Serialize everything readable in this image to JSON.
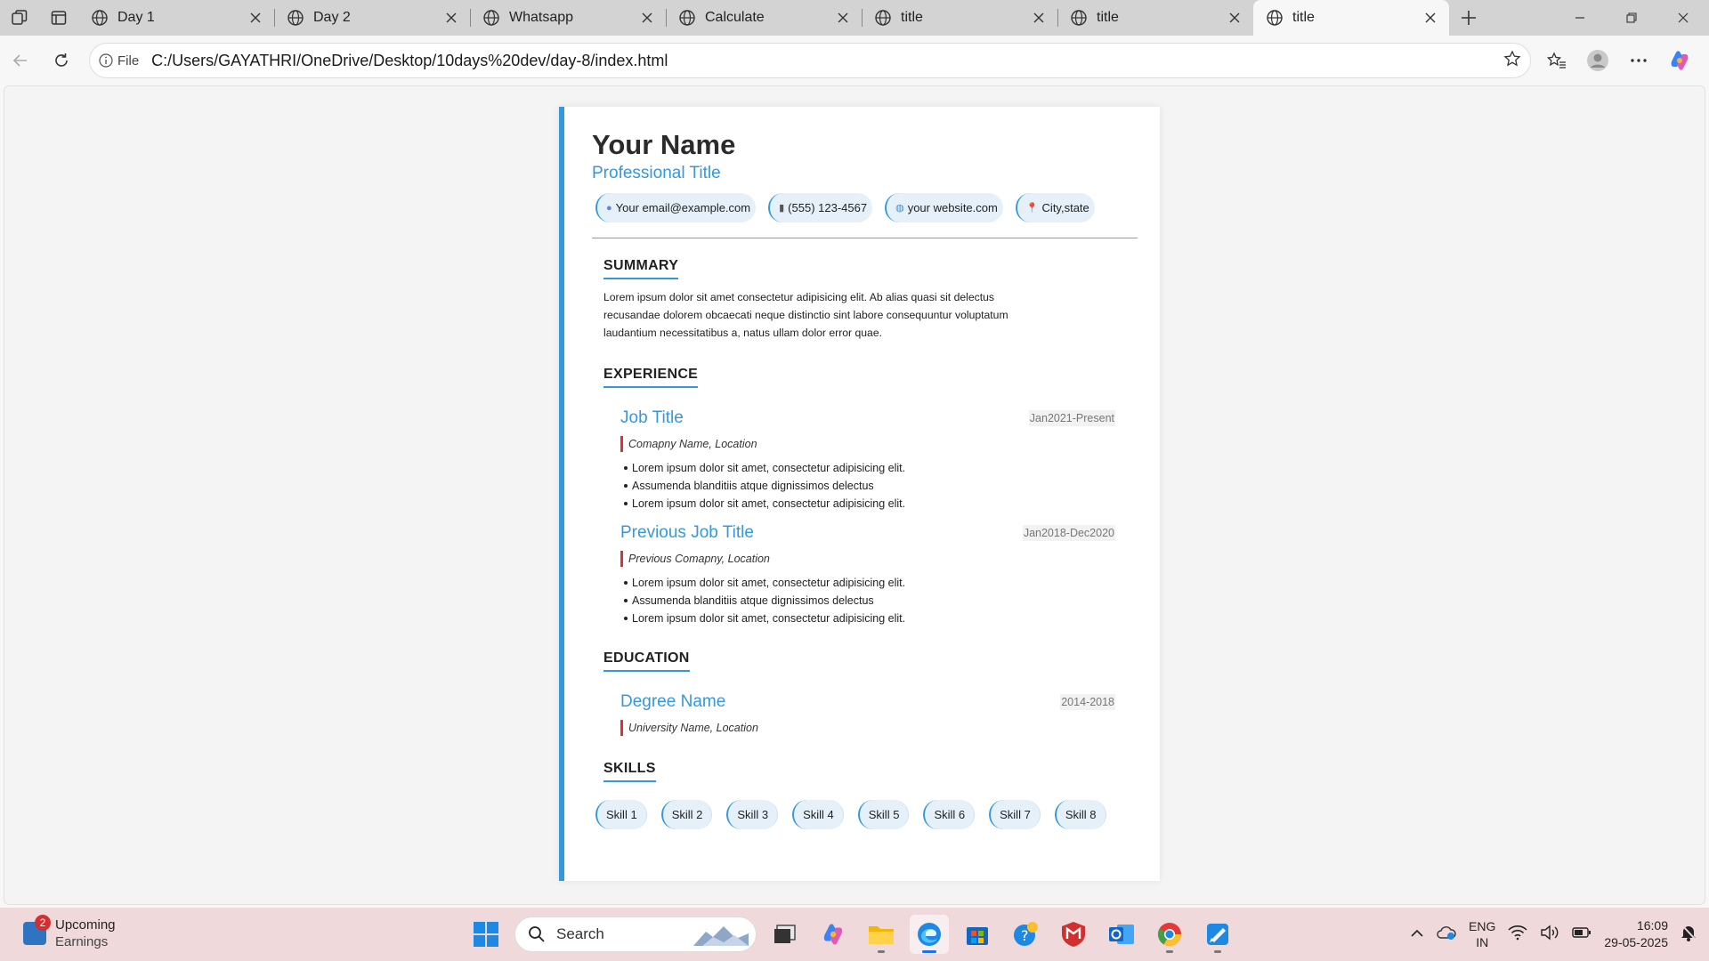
{
  "browser": {
    "tabs": [
      {
        "title": "Day 1",
        "active": false
      },
      {
        "title": "Day 2",
        "active": false
      },
      {
        "title": "Whatsapp",
        "active": false
      },
      {
        "title": "Calculate",
        "active": false
      },
      {
        "title": "title",
        "active": false
      },
      {
        "title": "title",
        "active": false
      },
      {
        "title": "title",
        "active": true
      }
    ],
    "address": {
      "scheme_label": "File",
      "url": "C:/Users/GAYATHRI/OneDrive/Desktop/10days%20dev/day-8/index.html"
    }
  },
  "resume": {
    "name": "Your Name",
    "title": "Professional Title",
    "contacts": [
      {
        "icon": "email-icon",
        "glyph": "●",
        "text": "Your email@example.com"
      },
      {
        "icon": "phone-icon",
        "glyph": "▮",
        "text": "(555) 123-4567"
      },
      {
        "icon": "globe-icon",
        "glyph": "◍",
        "text": "your website.com"
      },
      {
        "icon": "pin-icon",
        "glyph": "📍",
        "text": "City,state"
      }
    ],
    "summary": {
      "heading": "SUMMARY",
      "text": "Lorem ipsum dolor sit amet consectetur adipisicing elit. Ab alias quasi sit delectus recusandae dolorem obcaecati neque distinctio sint labore consequuntur voluptatum laudantium necessitatibus a, natus ullam dolor error quae."
    },
    "experience": {
      "heading": "EXPERIENCE",
      "jobs": [
        {
          "title": "Job Title",
          "date": "Jan2021-Present",
          "company": "Comapny Name, Location",
          "bullets": [
            "Lorem ipsum dolor sit amet, consectetur adipisicing elit.",
            "Assumenda blanditiis atque dignissimos delectus",
            "Lorem ipsum dolor sit amet, consectetur adipisicing elit."
          ]
        },
        {
          "title": "Previous Job Title",
          "date": "Jan2018-Dec2020",
          "company": "Previous Comapny, Location",
          "bullets": [
            "Lorem ipsum dolor sit amet, consectetur adipisicing elit.",
            "Assumenda blanditiis atque dignissimos delectus",
            "Lorem ipsum dolor sit amet, consectetur adipisicing elit."
          ]
        }
      ]
    },
    "education": {
      "heading": "EDUCATION",
      "degree": "Degree Name",
      "date": "2014-2018",
      "school": "University Name, Location"
    },
    "skills": {
      "heading": "SKILLS",
      "items": [
        "Skill 1",
        "Skill 2",
        "Skill 3",
        "Skill 4",
        "Skill 5",
        "Skill 6",
        "Skill 7",
        "Skill 8"
      ]
    }
  },
  "taskbar": {
    "widget": {
      "badge": "2",
      "line1": "Upcoming",
      "line2": "Earnings"
    },
    "search_placeholder": "Search",
    "lang": {
      "line1": "ENG",
      "line2": "IN"
    },
    "clock": {
      "time": "16:09",
      "date": "29-05-2025"
    }
  },
  "colors": {
    "accent": "#3498db",
    "company_marker": "#e23030",
    "pill_bg": "#e6f0f9",
    "taskbar_bg": "#efd9db"
  }
}
